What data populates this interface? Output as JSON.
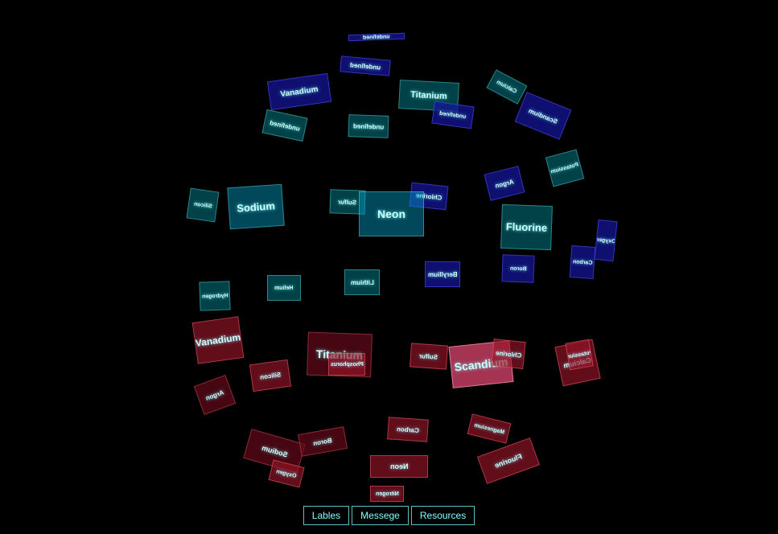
{
  "menu": {
    "buttons": [
      {
        "label": "Lables"
      },
      {
        "label": "Messege"
      },
      {
        "label": "Resources"
      }
    ]
  },
  "element_cards": [
    {
      "label": "undefined",
      "color": "navy",
      "mirrored": true
    },
    {
      "label": "undefined",
      "color": "navy",
      "mirrored": true
    },
    {
      "label": "Vanadium",
      "color": "navy",
      "mirrored": false
    },
    {
      "label": "Titanium",
      "color": "teal",
      "mirrored": false
    },
    {
      "label": "undefined",
      "color": "navy",
      "mirrored": true
    },
    {
      "label": "undefined",
      "color": "teal",
      "mirrored": true
    },
    {
      "label": "undefined",
      "color": "teal",
      "mirrored": true
    },
    {
      "label": "Scandium",
      "color": "navy",
      "mirrored": true
    },
    {
      "label": "Calcium",
      "color": "teal",
      "mirrored": true
    },
    {
      "label": "Potassium",
      "color": "teal",
      "mirrored": true
    },
    {
      "label": "Sodium",
      "color": "blue",
      "mirrored": false
    },
    {
      "label": "Silicon",
      "color": "teal",
      "mirrored": true
    },
    {
      "label": "Sulfur",
      "color": "teal",
      "mirrored": true
    },
    {
      "label": "Chlorine",
      "color": "navy",
      "mirrored": true
    },
    {
      "label": "Neon",
      "color": "blue",
      "mirrored": false
    },
    {
      "label": "Argon",
      "color": "navy",
      "mirrored": true
    },
    {
      "label": "Fluorine",
      "color": "teal",
      "mirrored": false
    },
    {
      "label": "Oxygen",
      "color": "navy",
      "mirrored": true
    },
    {
      "label": "Carbon",
      "color": "navy",
      "mirrored": true
    },
    {
      "label": "Boron",
      "color": "navy",
      "mirrored": true
    },
    {
      "label": "Beryllium",
      "color": "navy",
      "mirrored": true
    },
    {
      "label": "Lithium",
      "color": "teal",
      "mirrored": true
    },
    {
      "label": "Helium",
      "color": "teal",
      "mirrored": true
    },
    {
      "label": "Hydrogen",
      "color": "teal",
      "mirrored": true
    },
    {
      "label": "Vanadium",
      "color": "red",
      "mirrored": false
    },
    {
      "label": "Titanium",
      "color": "dred",
      "mirrored": false
    },
    {
      "label": "Phosphorus",
      "color": "red",
      "mirrored": true
    },
    {
      "label": "Silicon",
      "color": "red",
      "mirrored": true
    },
    {
      "label": "Sulfur",
      "color": "red",
      "mirrored": true
    },
    {
      "label": "Scandium",
      "color": "pink",
      "mirrored": false
    },
    {
      "label": "Chlorine",
      "color": "red",
      "mirrored": true
    },
    {
      "label": "Calcium",
      "color": "red",
      "mirrored": true
    },
    {
      "label": "Potassium",
      "color": "red",
      "mirrored": true
    },
    {
      "label": "Argon",
      "color": "dred",
      "mirrored": true
    },
    {
      "label": "Carbon",
      "color": "red",
      "mirrored": true
    },
    {
      "label": "Magnesium",
      "color": "red",
      "mirrored": true
    },
    {
      "label": "Sodium",
      "color": "dred",
      "mirrored": true
    },
    {
      "label": "Boron",
      "color": "dred",
      "mirrored": true
    },
    {
      "label": "Neon",
      "color": "red",
      "mirrored": true
    },
    {
      "label": "Fluorine",
      "color": "red",
      "mirrored": true
    },
    {
      "label": "Oxygen",
      "color": "red",
      "mirrored": true
    },
    {
      "label": "Nitrogen",
      "color": "red",
      "mirrored": true
    }
  ]
}
